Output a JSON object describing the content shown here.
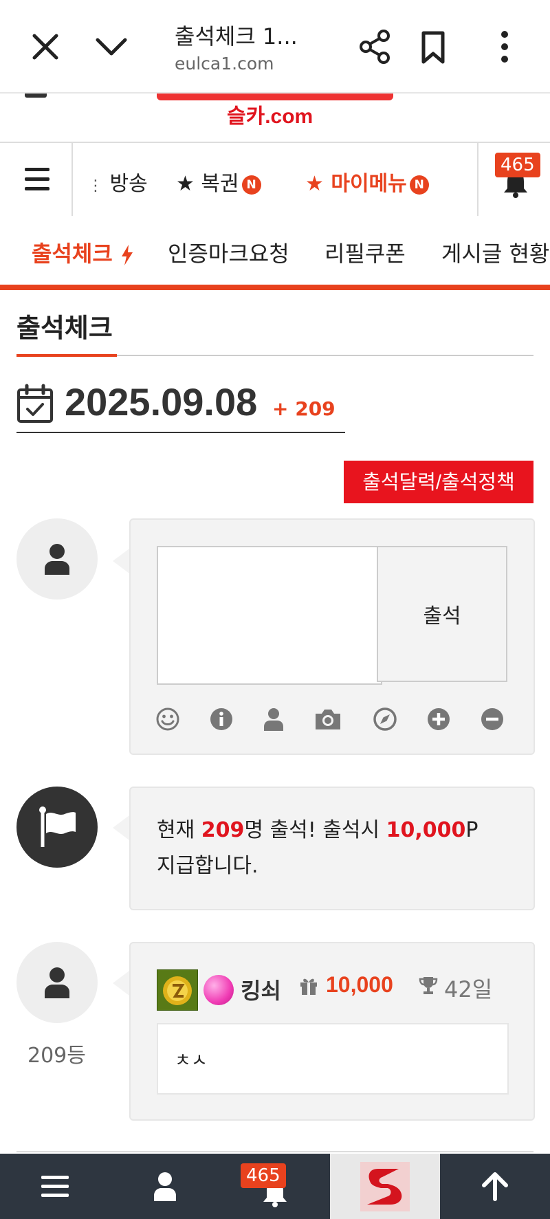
{
  "browser": {
    "tab_title": "출석체크 1...",
    "url": "eulca1.com"
  },
  "site": {
    "logo_text": "슬카.com"
  },
  "menu": {
    "items": [
      {
        "label": "방송",
        "prefix": "⋮"
      },
      {
        "label": "★ 복권",
        "badge": "N"
      },
      {
        "label": "★ 마이메뉴",
        "badge": "N"
      }
    ],
    "notification_count": "465"
  },
  "categories": [
    "출석체크",
    "인증마크요청",
    "리필쿠폰",
    "게시글 현황"
  ],
  "page": {
    "title": "출석체크",
    "date": "2025.09.08",
    "date_count": "+ 209",
    "calendar_button": "출석달력/출석정책"
  },
  "attend_form": {
    "textarea_value": "",
    "submit_label": "출석",
    "tools": [
      "emoji-icon",
      "info-icon",
      "user-icon",
      "camera-icon",
      "compass-icon",
      "plus-icon",
      "minus-icon"
    ]
  },
  "notice": {
    "pre": "현재 ",
    "count": "209",
    "mid": "명 출석! 출석시 ",
    "points": "10,000",
    "post": "P 지급합니다."
  },
  "entry": {
    "rank": "209등",
    "name": "킹쇠",
    "points": "10,000",
    "days": "42일",
    "comment": "ㅊㅅ"
  },
  "bottom_nav": {
    "notification_count": "465"
  },
  "colors": {
    "accent": "#e8421e",
    "red": "#e0141e",
    "nav_bg": "#2e3640"
  }
}
